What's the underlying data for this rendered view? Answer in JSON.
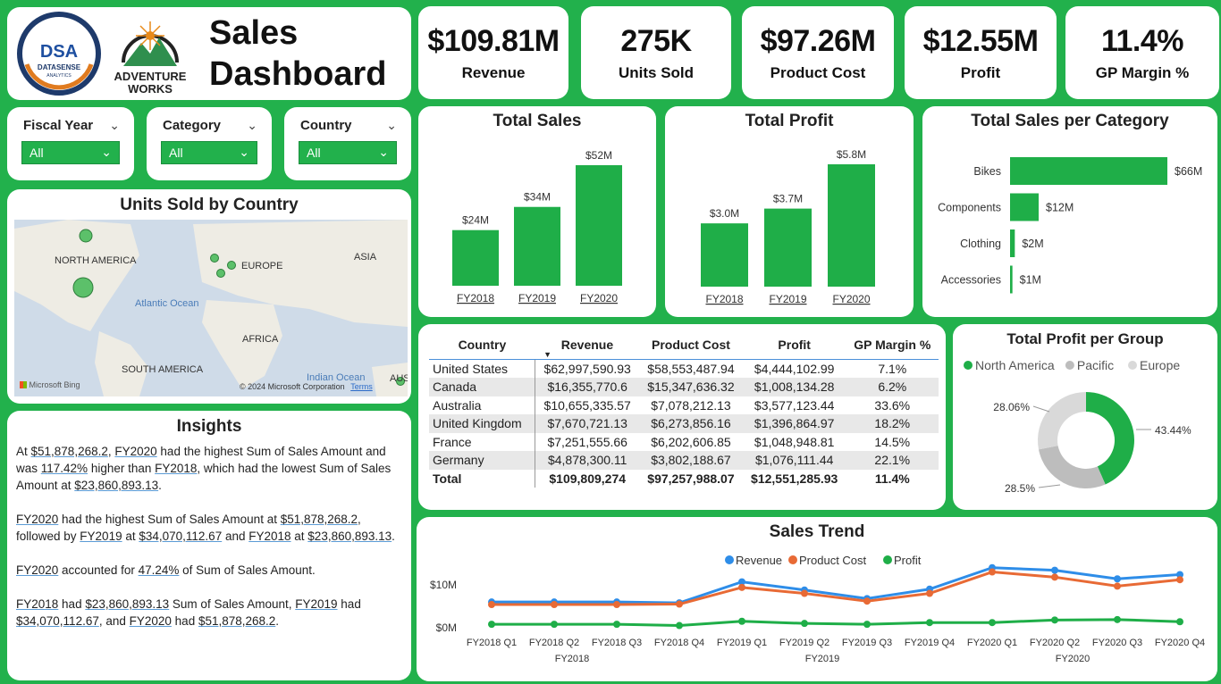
{
  "header": {
    "logo1_text": "DSA",
    "logo1_sub": "DATASENSE",
    "logo1_sub2": "ANALYTICS",
    "logo2_line1": "ADVENTURE",
    "logo2_line2": "WORKS",
    "title_line1": "Sales",
    "title_line2": "Dashboard"
  },
  "kpis": [
    {
      "value": "$109.81M",
      "label": "Revenue"
    },
    {
      "value": "275K",
      "label": "Units Sold"
    },
    {
      "value": "$97.26M",
      "label": "Product Cost"
    },
    {
      "value": "$12.55M",
      "label": "Profit"
    },
    {
      "value": "11.4%",
      "label": "GP Margin %"
    }
  ],
  "slicers": [
    {
      "label": "Fiscal Year",
      "value": "All"
    },
    {
      "label": "Category",
      "value": "All"
    },
    {
      "label": "Country",
      "value": "All"
    }
  ],
  "map": {
    "title": "Units Sold by Country",
    "labels": {
      "na": "NORTH AMERICA",
      "eu": "EUROPE",
      "asia": "ASIA",
      "africa": "AFRICA",
      "sa": "SOUTH AMERICA",
      "atlantic": "Atlantic Ocean",
      "indian": "Indian Ocean",
      "aus": "AUS"
    },
    "bing": "Microsoft Bing",
    "copyright": "© 2024 Microsoft Corporation",
    "terms": "Terms"
  },
  "insights": {
    "title": "Insights",
    "p1": {
      "a": "At ",
      "b": "$51,878,268.2",
      "c": ", ",
      "d": "FY2020",
      "e": " had the highest Sum of Sales Amount and was ",
      "f": "117.42%",
      "g": " higher than ",
      "h": "FY2018",
      "i": ", which had the lowest Sum of Sales Amount at ",
      "j": "$23,860,893.13",
      "k": "."
    },
    "p2": {
      "a": "FY2020",
      "b": " had the highest Sum of Sales Amount at ",
      "c": "$51,878,268.2",
      "d": ", followed by ",
      "e": "FY2019",
      "f": " at ",
      "g": "$34,070,112.67",
      "h": " and ",
      "i": "FY2018",
      "j": " at ",
      "k": "$23,860,893.13",
      "l": "."
    },
    "p3": {
      "a": "FY2020",
      "b": " accounted for ",
      "c": "47.24%",
      "d": " of Sum of Sales Amount."
    },
    "p4": {
      "a": "FY2018",
      "b": " had ",
      "c": "$23,860,893.13",
      "d": " Sum of Sales Amount, ",
      "e": "FY2019",
      "f": " had ",
      "g": "$34,070,112.67",
      "h": ", and ",
      "i": "FY2020",
      "j": " had ",
      "k": "$51,878,268.2",
      "l": "."
    }
  },
  "table": {
    "headers": [
      "Country",
      "Revenue",
      "Product Cost",
      "Profit",
      "GP Margin %"
    ],
    "rows": [
      [
        "United States",
        "$62,997,590.93",
        "$58,553,487.94",
        "$4,444,102.99",
        "7.1%"
      ],
      [
        "Canada",
        "$16,355,770.6",
        "$15,347,636.32",
        "$1,008,134.28",
        "6.2%"
      ],
      [
        "Australia",
        "$10,655,335.57",
        "$7,078,212.13",
        "$3,577,123.44",
        "33.6%"
      ],
      [
        "United Kingdom",
        "$7,670,721.13",
        "$6,273,856.16",
        "$1,396,864.97",
        "18.2%"
      ],
      [
        "France",
        "$7,251,555.66",
        "$6,202,606.85",
        "$1,048,948.81",
        "14.5%"
      ],
      [
        "Germany",
        "$4,878,300.11",
        "$3,802,188.67",
        "$1,076,111.44",
        "22.1%"
      ]
    ],
    "total": [
      "Total",
      "$109,809,274",
      "$97,257,988.07",
      "$12,551,285.93",
      "11.4%"
    ]
  },
  "colors": {
    "green": "#22b14c",
    "bar": "#1fae48",
    "blue": "#2e8de8",
    "orange": "#e86a35",
    "grey_mid": "#bdbdbd",
    "grey_light": "#d9d9d9"
  },
  "chart_data": [
    {
      "type": "bar",
      "title": "Total Sales",
      "categories": [
        "FY2018",
        "FY2019",
        "FY2020"
      ],
      "values": [
        24,
        34,
        52
      ],
      "data_labels": [
        "$24M",
        "$34M",
        "$52M"
      ],
      "unit": "M"
    },
    {
      "type": "bar",
      "title": "Total Profit",
      "categories": [
        "FY2018",
        "FY2019",
        "FY2020"
      ],
      "values": [
        3.0,
        3.7,
        5.8
      ],
      "data_labels": [
        "$3.0M",
        "$3.7M",
        "$5.8M"
      ],
      "unit": "M"
    },
    {
      "type": "bar",
      "orientation": "horizontal",
      "title": "Total Sales per Category",
      "categories": [
        "Bikes",
        "Components",
        "Clothing",
        "Accessories"
      ],
      "values": [
        66,
        12,
        2,
        1
      ],
      "data_labels": [
        "$66M",
        "$12M",
        "$2M",
        "$1M"
      ],
      "unit": "M"
    },
    {
      "type": "pie",
      "donut": true,
      "title": "Total Profit per Group",
      "legend_position": "top-left",
      "labels": [
        "North America",
        "Pacific",
        "Europe"
      ],
      "values": [
        43.44,
        28.5,
        28.06
      ],
      "data_labels": [
        "43.44%",
        "28.5%",
        "28.06%"
      ]
    },
    {
      "type": "line",
      "title": "Sales Trend",
      "legend_position": "top",
      "categories": [
        "FY2018 Q1",
        "FY2018 Q2",
        "FY2018 Q3",
        "FY2018 Q4",
        "FY2019 Q1",
        "FY2019 Q2",
        "FY2019 Q3",
        "FY2019 Q4",
        "FY2020 Q1",
        "FY2020 Q2",
        "FY2020 Q3",
        "FY2020 Q4"
      ],
      "category_groups": [
        "FY2018",
        "FY2019",
        "FY2020"
      ],
      "yticks": [
        "$0M",
        "$10M"
      ],
      "ylim": [
        0,
        12
      ],
      "series": [
        {
          "name": "Revenue",
          "values": [
            5.8,
            5.8,
            5.8,
            5.6,
            10.5,
            8.6,
            6.6,
            8.8,
            13.8,
            13.2,
            11.2,
            12.2
          ]
        },
        {
          "name": "Product Cost",
          "values": [
            5.2,
            5.2,
            5.2,
            5.3,
            9.2,
            7.8,
            6.0,
            7.8,
            12.8,
            11.6,
            9.5,
            11.0
          ]
        },
        {
          "name": "Profit",
          "values": [
            0.6,
            0.6,
            0.6,
            0.3,
            1.3,
            0.8,
            0.6,
            1.0,
            1.0,
            1.6,
            1.7,
            1.2
          ]
        }
      ]
    }
  ]
}
